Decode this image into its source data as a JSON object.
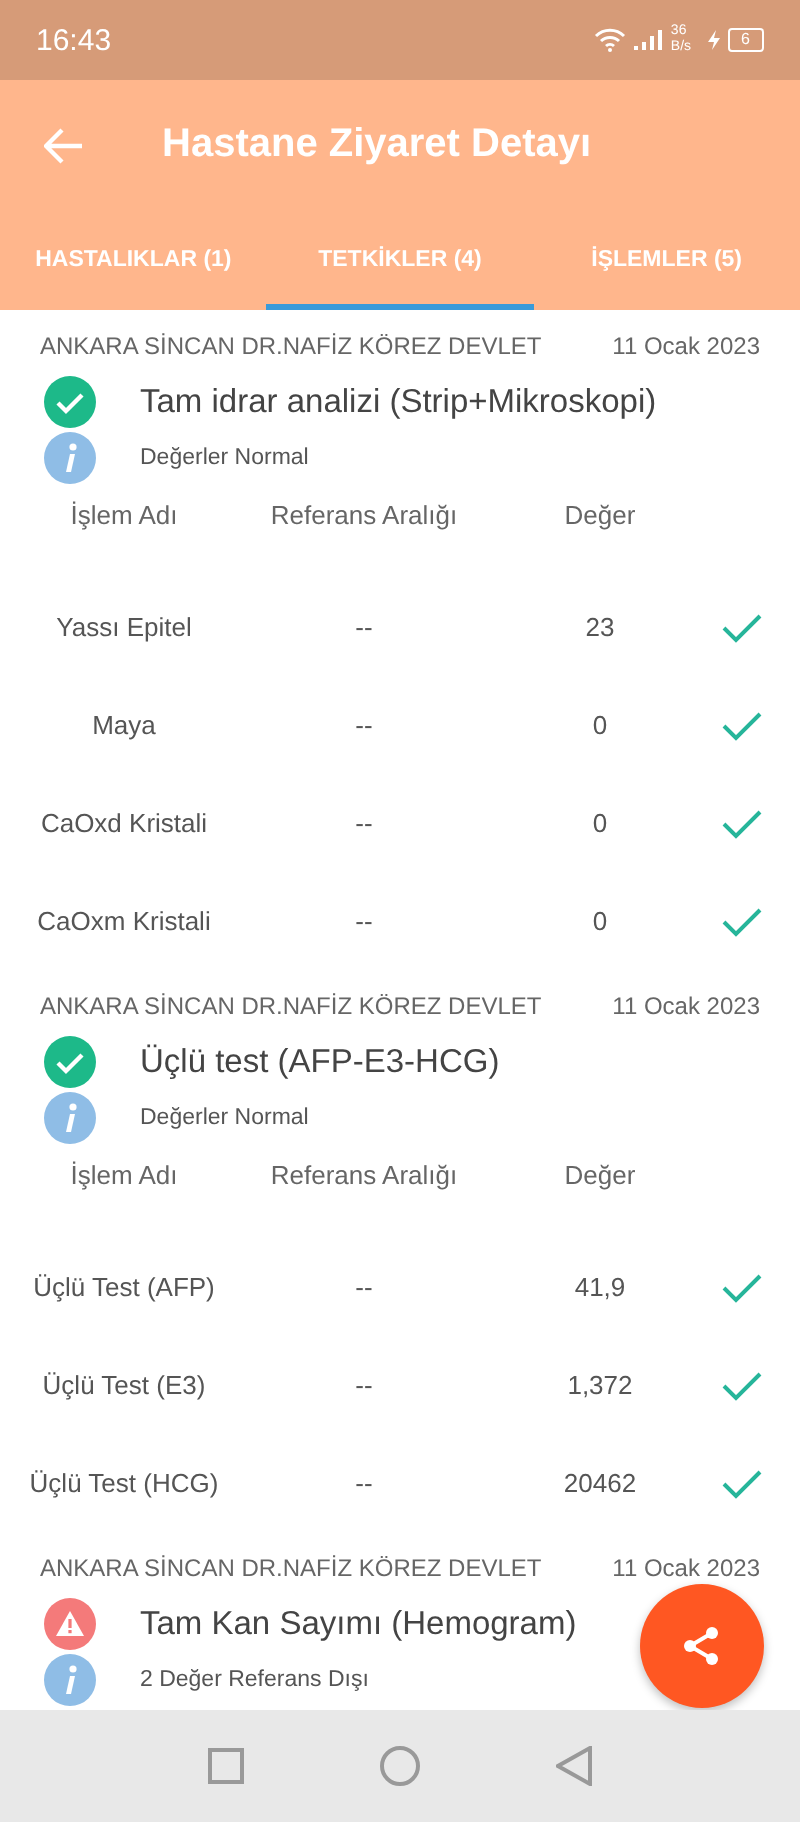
{
  "status_bar": {
    "time": "16:43",
    "speed": "36",
    "speed_unit": "B/s",
    "battery": "6"
  },
  "app_bar": {
    "title": "Hastane Ziyaret Detayı"
  },
  "tabs": [
    {
      "label": "HASTALIKLAR (1)",
      "selected": false
    },
    {
      "label": "TETKİKLER (4)",
      "selected": true
    },
    {
      "label": "İŞLEMLER (5)",
      "selected": false
    }
  ],
  "tests": [
    {
      "hospital": "ANKARA SİNCAN DR.NAFİZ KÖREZ DEVLET",
      "date": "11 Ocak 2023",
      "kind": "ok",
      "title": "Tam idrar analizi (Strip+Mikroskopi)",
      "summary": "Değerler Normal",
      "columns": [
        "İşlem Adı",
        "Referans Aralığı",
        "Değer"
      ],
      "rows": [
        {
          "name": "Yassı Epitel",
          "range": "--",
          "value": "23",
          "in_range": true
        },
        {
          "name": "Maya",
          "range": "--",
          "value": "0",
          "in_range": true
        },
        {
          "name": "CaOxd Kristali",
          "range": "--",
          "value": "0",
          "in_range": true
        },
        {
          "name": "CaOxm Kristali",
          "range": "--",
          "value": "0",
          "in_range": true
        }
      ]
    },
    {
      "hospital": "ANKARA SİNCAN DR.NAFİZ KÖREZ DEVLET",
      "date": "11 Ocak 2023",
      "kind": "ok",
      "title": "Üçlü test (AFP-E3-HCG)",
      "summary": "Değerler Normal",
      "columns": [
        "İşlem Adı",
        "Referans Aralığı",
        "Değer"
      ],
      "rows": [
        {
          "name": "Üçlü Test (AFP)",
          "range": "--",
          "value": "41,9",
          "in_range": true
        },
        {
          "name": "Üçlü Test (E3)",
          "range": "--",
          "value": "1,372",
          "in_range": true
        },
        {
          "name": "Üçlü Test (HCG)",
          "range": "--",
          "value": "20462",
          "in_range": true
        }
      ]
    },
    {
      "hospital": "ANKARA SİNCAN DR.NAFİZ KÖREZ DEVLET",
      "date": "11 Ocak 2023",
      "kind": "warning",
      "title": "Tam Kan Sayımı (Hemogram)",
      "summary": "2 Değer Referans Dışı"
    }
  ]
}
